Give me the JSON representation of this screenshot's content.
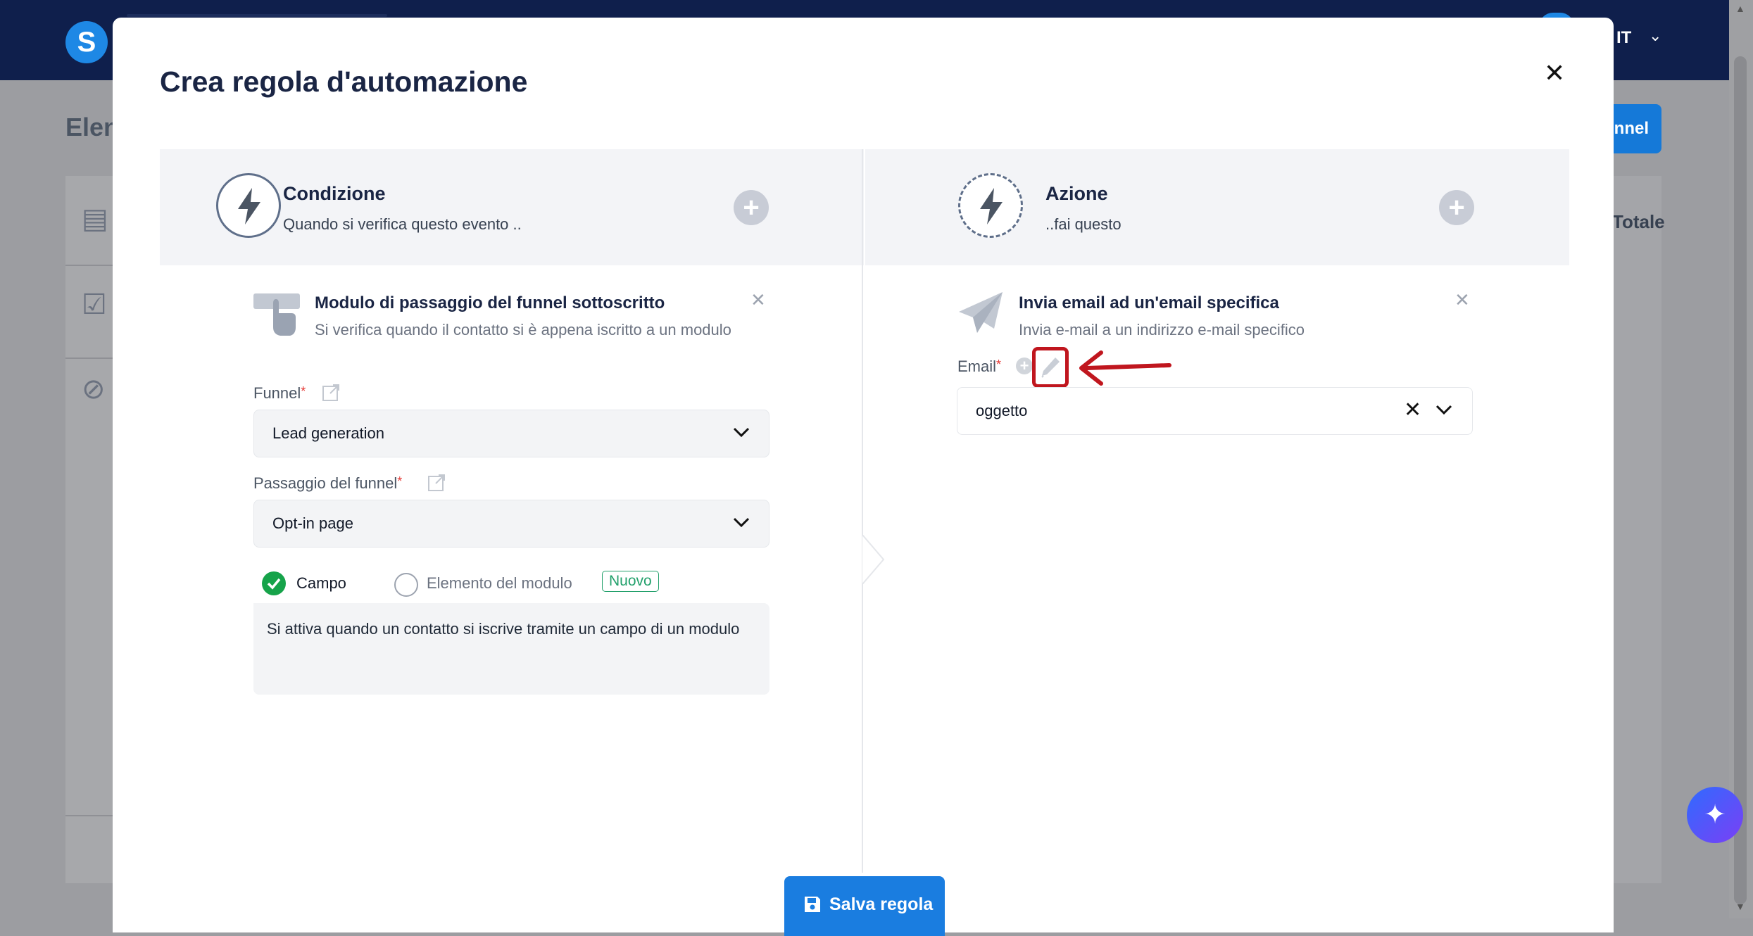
{
  "app": {
    "logo_letter": "S",
    "page_title": "Elen",
    "new_funnel_label": "nnel",
    "language": "IT",
    "table_total_header": "Totale"
  },
  "modal": {
    "title": "Crea regola d'automazione",
    "close_icon": "close-icon",
    "condition": {
      "title": "Condizione",
      "subtitle": "Quando si verifica questo evento ..",
      "trigger_title": "Modulo di passaggio del funnel sottoscritto",
      "trigger_desc": "Si verifica quando il contatto si è appena iscritto a un modulo",
      "funnel_label": "Funnel",
      "funnel_value": "Lead generation",
      "step_label": "Passaggio del funnel",
      "step_value": "Opt-in page",
      "tab_field": "Campo",
      "tab_form_element": "Elemento del modulo",
      "badge_new": "Nuovo",
      "info_text": "Si attiva quando un contatto si iscrive tramite un campo di un modulo"
    },
    "action": {
      "title": "Azione",
      "subtitle": "..fai questo",
      "action_title": "Invia email ad un'email specifica",
      "action_desc": "Invia e-mail a un indirizzo e-mail specifico",
      "email_label": "Email",
      "email_value": "oggetto"
    },
    "save_label": "Salva regola"
  },
  "colors": {
    "navy": "#0f1f4c",
    "primary": "#1a7de0",
    "success": "#16a34a",
    "highlight_red": "#c0161e"
  }
}
